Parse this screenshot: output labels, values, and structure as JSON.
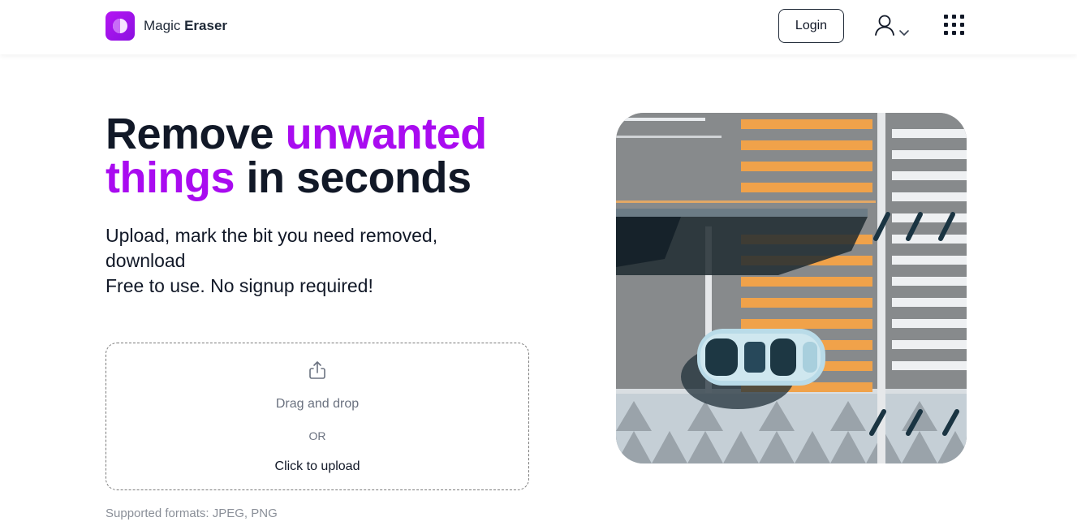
{
  "header": {
    "brand_light": "Magic",
    "brand_bold": "Eraser",
    "login_label": "Login",
    "icons": {
      "user": "user-icon",
      "chevron": "chevron-down-icon",
      "apps": "apps-grid-icon"
    }
  },
  "hero": {
    "headline_part1": "Remove ",
    "headline_accent1": "unwanted",
    "headline_accent2": "things",
    "headline_part2": " in seconds",
    "subtext_line1": "Upload, mark the bit you need removed, download",
    "subtext_line2": "Free to use. No signup required!"
  },
  "upload": {
    "drag_label": "Drag and drop",
    "or_label": "OR",
    "click_label": "Click to upload",
    "formats_label": "Supported formats: JPEG, PNG",
    "icon": "upload-icon"
  },
  "colors": {
    "accent": "#a90bf0",
    "text": "#111827",
    "muted": "#6b7280"
  }
}
